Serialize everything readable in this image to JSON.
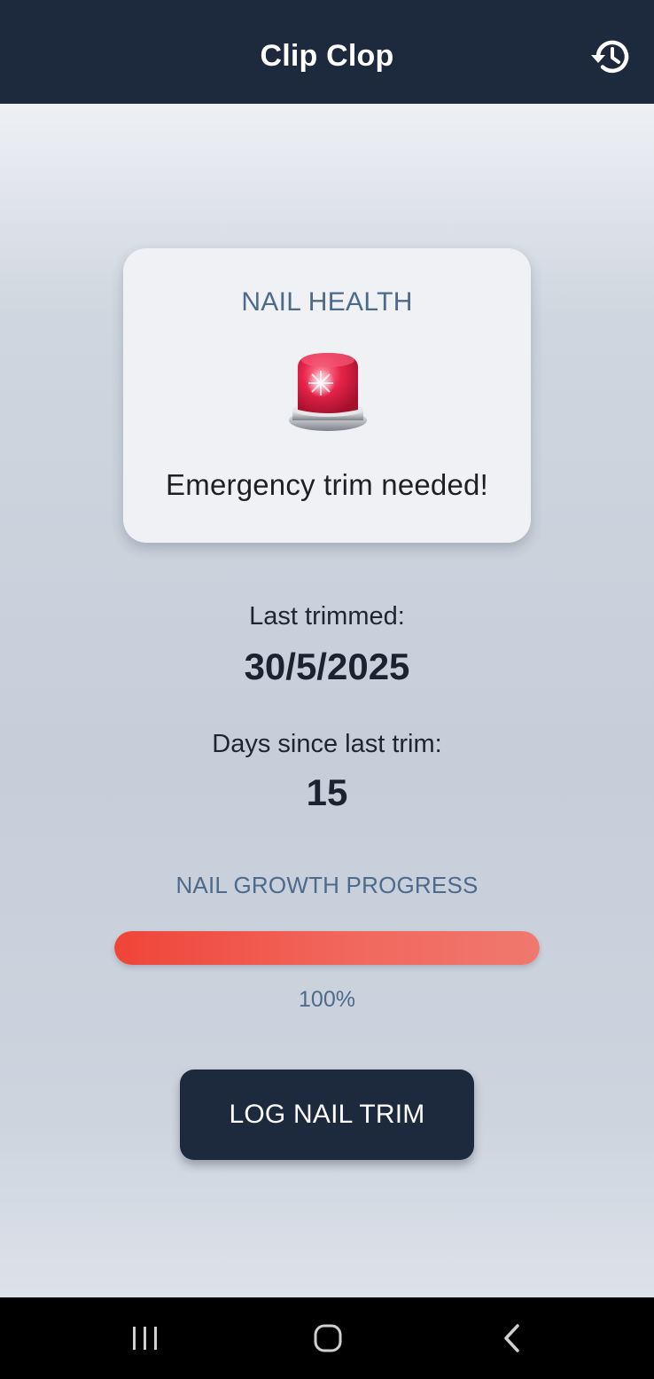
{
  "app_bar": {
    "title": "Clip Clop",
    "history_icon": "history-icon"
  },
  "card": {
    "title": "NAIL HEALTH",
    "icon": "police-siren-icon",
    "status": "Emergency trim needed!"
  },
  "last_trimmed": {
    "label": "Last trimmed:",
    "value": "30/5/2025"
  },
  "days_since": {
    "label": "Days since last trim:",
    "value": "15"
  },
  "growth": {
    "title": "NAIL GROWTH PROGRESS",
    "percent": 100,
    "percent_label": "100%"
  },
  "actions": {
    "log_trim_label": "LOG NAIL TRIM"
  },
  "nav": {
    "recents_icon": "recents-icon",
    "home_icon": "home-icon",
    "back_icon": "back-icon"
  },
  "colors": {
    "app_bar": "#1d2a3d",
    "accent_text": "#4d6a8a",
    "progress_start": "#f04438",
    "progress_end": "#f0786e",
    "button": "#1d2a3d"
  }
}
